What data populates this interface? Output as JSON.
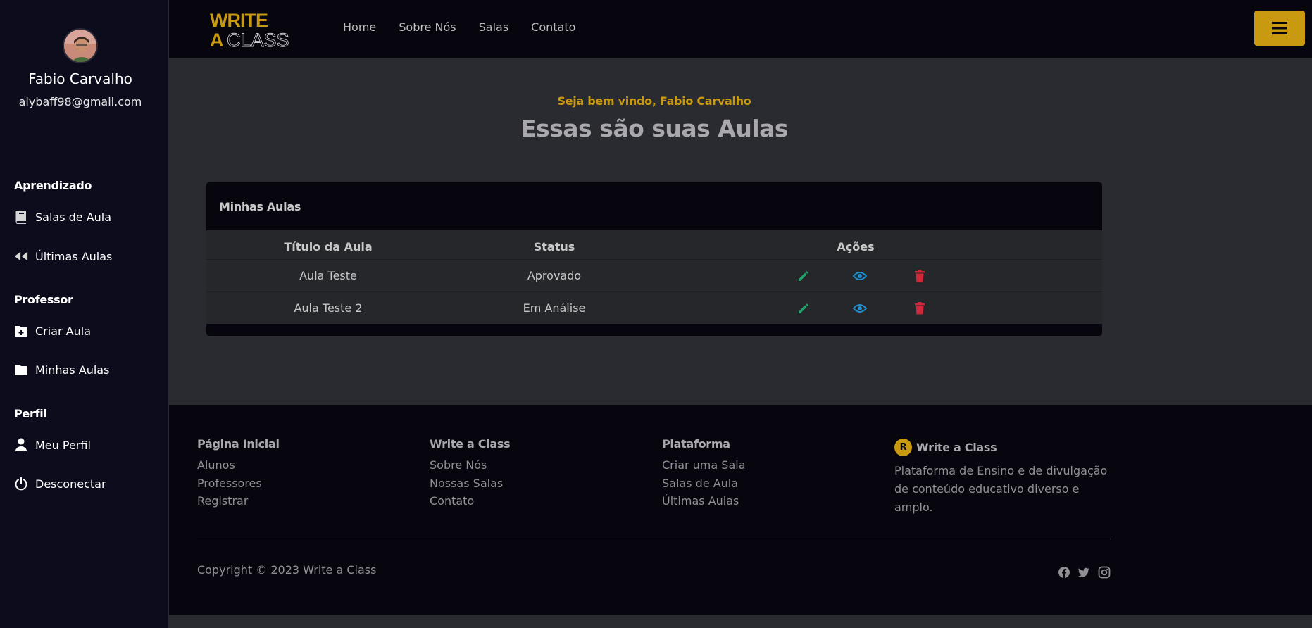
{
  "user": {
    "name": "Fabio Carvalho",
    "email": "alybaff98@gmail.com"
  },
  "sidebar": {
    "sections": [
      {
        "heading": "Aprendizado",
        "items": [
          {
            "label": "Salas de Aula",
            "icon": "book-icon"
          },
          {
            "label": "Últimas Aulas",
            "icon": "rewind-icon"
          }
        ]
      },
      {
        "heading": "Professor",
        "items": [
          {
            "label": "Criar Aula",
            "icon": "folder-plus-icon"
          },
          {
            "label": "Minhas Aulas",
            "icon": "folder-icon"
          }
        ]
      },
      {
        "heading": "Perfil",
        "items": [
          {
            "label": "Meu Perfil",
            "icon": "user-icon"
          },
          {
            "label": "Desconectar",
            "icon": "power-icon"
          }
        ]
      }
    ]
  },
  "header": {
    "logo_line1": "WRITE",
    "logo_line2_a": "A",
    "logo_line2_b": "CLASS",
    "nav": [
      "Home",
      "Sobre Nós",
      "Salas",
      "Contato"
    ]
  },
  "main": {
    "welcome": "Seja bem vindo, Fabio Carvalho",
    "title": "Essas são suas Aulas",
    "card_title": "Minhas Aulas",
    "columns": [
      "Título da Aula",
      "Status",
      "Ações"
    ],
    "rows": [
      {
        "title": "Aula Teste",
        "status": "Aprovado"
      },
      {
        "title": "Aula Teste 2",
        "status": "Em Análise"
      }
    ]
  },
  "footer": {
    "columns": [
      {
        "heading": "Página Inicial",
        "links": [
          "Alunos",
          "Professores",
          "Registrar"
        ]
      },
      {
        "heading": "Write a Class",
        "links": [
          "Sobre Nós",
          "Nossas Salas",
          "Contato"
        ]
      },
      {
        "heading": "Plataforma",
        "links": [
          "Criar uma Sala",
          "Salas de Aula",
          "Últimas Aulas"
        ]
      }
    ],
    "brand_badge": "R",
    "brand_name": "Write a Class",
    "description": "Plataforma de Ensino e de divulgação de conteúdo educativo diverso e amplo.",
    "copyright": "Copyright © 2023 Write a Class",
    "social": [
      "facebook-icon",
      "twitter-icon",
      "instagram-icon"
    ]
  },
  "colors": {
    "accent": "#c9990f",
    "edit": "#1fa36b",
    "view": "#1d8fd0",
    "delete": "#d0273a"
  }
}
